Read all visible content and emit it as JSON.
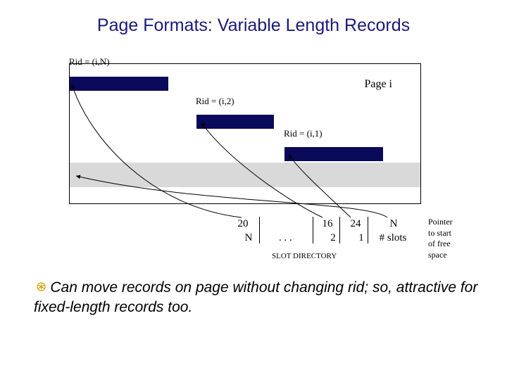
{
  "title": "Page Formats: Variable Length Records",
  "page_label": "Page i",
  "rids": {
    "n": "Rid = (i,N)",
    "two": "Rid = (i,2)",
    "one": "Rid = (i,1)"
  },
  "directory": {
    "top": {
      "c20": "20",
      "c16": "16",
      "c24": "24",
      "cN": "N"
    },
    "bot": {
      "cN": "N",
      "dots": ". . .",
      "c2": "2",
      "c1": "1",
      "slots": "# slots"
    },
    "label": "SLOT DIRECTORY"
  },
  "pointer_note": {
    "l1": "Pointer",
    "l2": "to start",
    "l3": "of free",
    "l4": "space"
  },
  "main_text": "Can move records on page without changing rid; so, attractive for fixed-length records too."
}
